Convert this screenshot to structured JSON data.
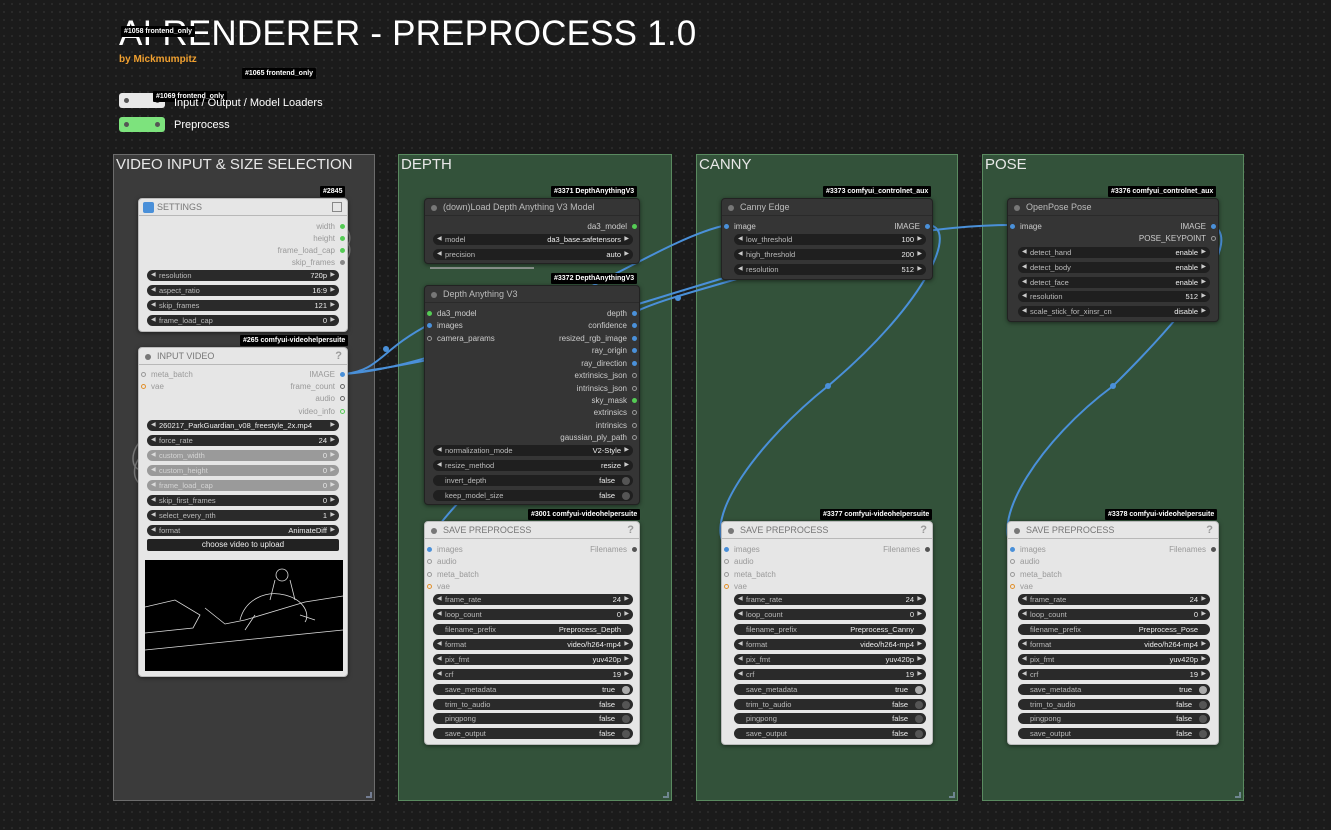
{
  "header": {
    "title": "AI RENDERER - PREPROCESS 1.0",
    "author": "by Mickmumpitz"
  },
  "top_tags": {
    "t1": "#1058 frontend_only",
    "t2": "#1065 frontend_only",
    "t3": "#1069 frontend_only"
  },
  "legend": [
    {
      "label": "Input / Output / Model Loaders",
      "color": "#e8e8e8"
    },
    {
      "label": "Preprocess",
      "color": "#7de37d"
    }
  ],
  "groups": {
    "video": "VIDEO INPUT & SIZE SELECTION",
    "depth": "DEPTH",
    "canny": "CANNY",
    "pose": "POSE"
  },
  "settings": {
    "tag": "#2845",
    "title": "SETTINGS",
    "outputs": [
      "width",
      "height",
      "frame_load_cap",
      "skip_frames"
    ],
    "widgets": [
      {
        "label": "resolution",
        "value": "720p"
      },
      {
        "label": "aspect_ratio",
        "value": "16:9"
      },
      {
        "label": "skip_frames",
        "value": "121"
      },
      {
        "label": "frame_load_cap",
        "value": "0"
      }
    ]
  },
  "input_video": {
    "tag": "#265 comfyui-videohelpersuite",
    "title": "INPUT VIDEO",
    "inputs": [
      "meta_batch",
      "vae"
    ],
    "outputs": [
      "IMAGE",
      "frame_count",
      "audio",
      "video_info"
    ],
    "widgets": [
      {
        "label": "",
        "value": "260217_ParkGuardian_v08_freestyle_2x.mp4"
      },
      {
        "label": "force_rate",
        "value": "24"
      },
      {
        "label": "custom_width",
        "value": "0"
      },
      {
        "label": "custom_height",
        "value": "0"
      },
      {
        "label": "frame_load_cap",
        "value": "0"
      },
      {
        "label": "skip_first_frames",
        "value": "0"
      },
      {
        "label": "select_every_nth",
        "value": "1"
      },
      {
        "label": "format",
        "value": "AnimateDiff"
      }
    ],
    "upload_button": "choose video to upload"
  },
  "load_depth": {
    "tag": "#3371 DepthAnythingV3",
    "title": "(down)Load Depth Anything V3 Model",
    "output": "da3_model",
    "widgets": [
      {
        "label": "model",
        "value": "da3_base.safetensors"
      },
      {
        "label": "precision",
        "value": "auto"
      }
    ]
  },
  "depth_any": {
    "tag": "#3372 DepthAnythingV3",
    "title": "Depth Anything V3",
    "inputs": [
      "da3_model",
      "images",
      "camera_params"
    ],
    "outputs": [
      "depth",
      "confidence",
      "resized_rgb_image",
      "ray_origin",
      "ray_direction",
      "extrinsics_json",
      "intrinsics_json",
      "sky_mask",
      "extrinsics",
      "intrinsics",
      "gaussian_ply_path"
    ],
    "widgets": [
      {
        "label": "normalization_mode",
        "value": "V2-Style"
      },
      {
        "label": "resize_method",
        "value": "resize"
      },
      {
        "label": "invert_depth",
        "value": "false"
      },
      {
        "label": "keep_model_size",
        "value": "false"
      }
    ]
  },
  "canny": {
    "tag": "#3373 comfyui_controlnet_aux",
    "title": "Canny Edge",
    "input": "image",
    "output": "IMAGE",
    "widgets": [
      {
        "label": "low_threshold",
        "value": "100"
      },
      {
        "label": "high_threshold",
        "value": "200"
      },
      {
        "label": "resolution",
        "value": "512"
      }
    ]
  },
  "openpose": {
    "tag": "#3376 comfyui_controlnet_aux",
    "title": "OpenPose Pose",
    "input": "image",
    "outputs": [
      "IMAGE",
      "POSE_KEYPOINT"
    ],
    "widgets": [
      {
        "label": "detect_hand",
        "value": "enable"
      },
      {
        "label": "detect_body",
        "value": "enable"
      },
      {
        "label": "detect_face",
        "value": "enable"
      },
      {
        "label": "resolution",
        "value": "512"
      },
      {
        "label": "scale_stick_for_xinsr_cn",
        "value": "disable"
      }
    ]
  },
  "save_nodes": [
    {
      "tag": "#3001 comfyui-videohelpersuite",
      "title": "SAVE PREPROCESS",
      "inputs": [
        "images",
        "audio",
        "meta_batch",
        "vae"
      ],
      "output": "Filenames",
      "widgets": [
        {
          "label": "frame_rate",
          "value": "24"
        },
        {
          "label": "loop_count",
          "value": "0"
        },
        {
          "label": "filename_prefix",
          "value": "Preprocess_Depth"
        },
        {
          "label": "format",
          "value": "video/h264-mp4"
        },
        {
          "label": "pix_fmt",
          "value": "yuv420p"
        },
        {
          "label": "crf",
          "value": "19"
        },
        {
          "label": "save_metadata",
          "value": "true"
        },
        {
          "label": "trim_to_audio",
          "value": "false"
        },
        {
          "label": "pingpong",
          "value": "false"
        },
        {
          "label": "save_output",
          "value": "false"
        }
      ]
    },
    {
      "tag": "#3377 comfyui-videohelpersuite",
      "title": "SAVE PREPROCESS",
      "inputs": [
        "images",
        "audio",
        "meta_batch",
        "vae"
      ],
      "output": "Filenames",
      "widgets": [
        {
          "label": "frame_rate",
          "value": "24"
        },
        {
          "label": "loop_count",
          "value": "0"
        },
        {
          "label": "filename_prefix",
          "value": "Preprocess_Canny"
        },
        {
          "label": "format",
          "value": "video/h264-mp4"
        },
        {
          "label": "pix_fmt",
          "value": "yuv420p"
        },
        {
          "label": "crf",
          "value": "19"
        },
        {
          "label": "save_metadata",
          "value": "true"
        },
        {
          "label": "trim_to_audio",
          "value": "false"
        },
        {
          "label": "pingpong",
          "value": "false"
        },
        {
          "label": "save_output",
          "value": "false"
        }
      ]
    },
    {
      "tag": "#3378 comfyui-videohelpersuite",
      "title": "SAVE PREPROCESS",
      "inputs": [
        "images",
        "audio",
        "meta_batch",
        "vae"
      ],
      "output": "Filenames",
      "widgets": [
        {
          "label": "frame_rate",
          "value": "24"
        },
        {
          "label": "loop_count",
          "value": "0"
        },
        {
          "label": "filename_prefix",
          "value": "Preprocess_Pose"
        },
        {
          "label": "format",
          "value": "video/h264-mp4"
        },
        {
          "label": "pix_fmt",
          "value": "yuv420p"
        },
        {
          "label": "crf",
          "value": "19"
        },
        {
          "label": "save_metadata",
          "value": "true"
        },
        {
          "label": "trim_to_audio",
          "value": "false"
        },
        {
          "label": "pingpong",
          "value": "false"
        },
        {
          "label": "save_output",
          "value": "false"
        }
      ]
    }
  ],
  "colors": {
    "link": "#4a90d9",
    "group_green": "#33523a",
    "group_gray": "#3b3b3b"
  }
}
